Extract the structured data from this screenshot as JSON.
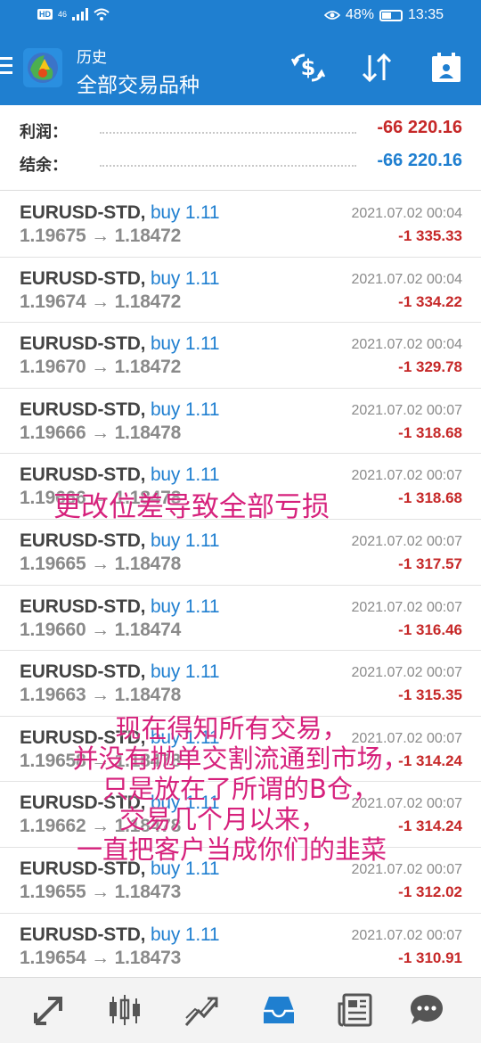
{
  "status_bar": {
    "hd": "HD",
    "network": "46",
    "battery": "48%",
    "battery_level": 0.48,
    "time": "13:35"
  },
  "header": {
    "subtitle": "历史",
    "title": "全部交易品种",
    "icons": [
      "menu-icon",
      "app-logo",
      "exchange-dollar-icon",
      "sort-arrows-icon",
      "calendar-icon"
    ]
  },
  "summary": {
    "profit_label": "利润：",
    "profit_value": "-66 220.16",
    "profit_color": "#c62828",
    "balance_label": "结余：",
    "balance_value": "-66 220.16",
    "balance_color": "#1f7fd0"
  },
  "trades": [
    {
      "symbol": "EURUSD-STD,",
      "side": "buy 1.11",
      "open": "1.19675",
      "close": "1.18472",
      "arrow": "→",
      "date": "2021.07.02 00:04",
      "profit": "-1 335.33"
    },
    {
      "symbol": "EURUSD-STD,",
      "side": "buy 1.11",
      "open": "1.19674",
      "close": "1.18472",
      "arrow": "→",
      "date": "2021.07.02 00:04",
      "profit": "-1 334.22"
    },
    {
      "symbol": "EURUSD-STD,",
      "side": "buy 1.11",
      "open": "1.19670",
      "close": "1.18472",
      "arrow": "→",
      "date": "2021.07.02 00:04",
      "profit": "-1 329.78"
    },
    {
      "symbol": "EURUSD-STD,",
      "side": "buy 1.11",
      "open": "1.19666",
      "close": "1.18478",
      "arrow": "→",
      "date": "2021.07.02 00:07",
      "profit": "-1 318.68"
    },
    {
      "symbol": "EURUSD-STD,",
      "side": "buy 1.11",
      "open": "1.19666",
      "close": "1.18478",
      "arrow": "→",
      "date": "2021.07.02 00:07",
      "profit": "-1 318.68"
    },
    {
      "symbol": "EURUSD-STD,",
      "side": "buy 1.11",
      "open": "1.19665",
      "close": "1.18478",
      "arrow": "→",
      "date": "2021.07.02 00:07",
      "profit": "-1 317.57"
    },
    {
      "symbol": "EURUSD-STD,",
      "side": "buy 1.11",
      "open": "1.19660",
      "close": "1.18474",
      "arrow": "→",
      "date": "2021.07.02 00:07",
      "profit": "-1 316.46"
    },
    {
      "symbol": "EURUSD-STD,",
      "side": "buy 1.11",
      "open": "1.19663",
      "close": "1.18478",
      "arrow": "→",
      "date": "2021.07.02 00:07",
      "profit": "-1 315.35"
    },
    {
      "symbol": "EURUSD-STD,",
      "side": "buy 1.11",
      "open": "1.19658",
      "close": "1.18478",
      "arrow": "→",
      "date": "2021.07.02 00:07",
      "profit": "-1 314.24"
    },
    {
      "symbol": "EURUSD-STD,",
      "side": "buy 1.11",
      "open": "1.19662",
      "close": "1.18478",
      "arrow": "→",
      "date": "2021.07.02 00:07",
      "profit": "-1 314.24"
    },
    {
      "symbol": "EURUSD-STD,",
      "side": "buy 1.11",
      "open": "1.19655",
      "close": "1.18473",
      "arrow": "→",
      "date": "2021.07.02 00:07",
      "profit": "-1 312.02"
    },
    {
      "symbol": "EURUSD-STD,",
      "side": "buy 1.11",
      "open": "1.19654",
      "close": "1.18473",
      "arrow": "→",
      "date": "2021.07.02 00:07",
      "profit": "-1 310.91"
    }
  ],
  "annotations": {
    "overlay_1": "更改位差导致全部亏损",
    "overlay_2_lines": [
      "现在得知所有交易，",
      "并没有抛单交割流通到市场，",
      "只是放在了所谓的B仓，",
      "交易几个月以来，",
      "一直把客户当成你们的韭菜"
    ]
  },
  "tabbar": {
    "tabs": [
      "quotes-arrows-icon",
      "chart-candles-icon",
      "trade-line-icon",
      "history-inbox-icon",
      "news-icon",
      "chat-icon"
    ],
    "active_index": 3,
    "active_color": "#1f7fd0",
    "inactive_color": "#555555"
  }
}
